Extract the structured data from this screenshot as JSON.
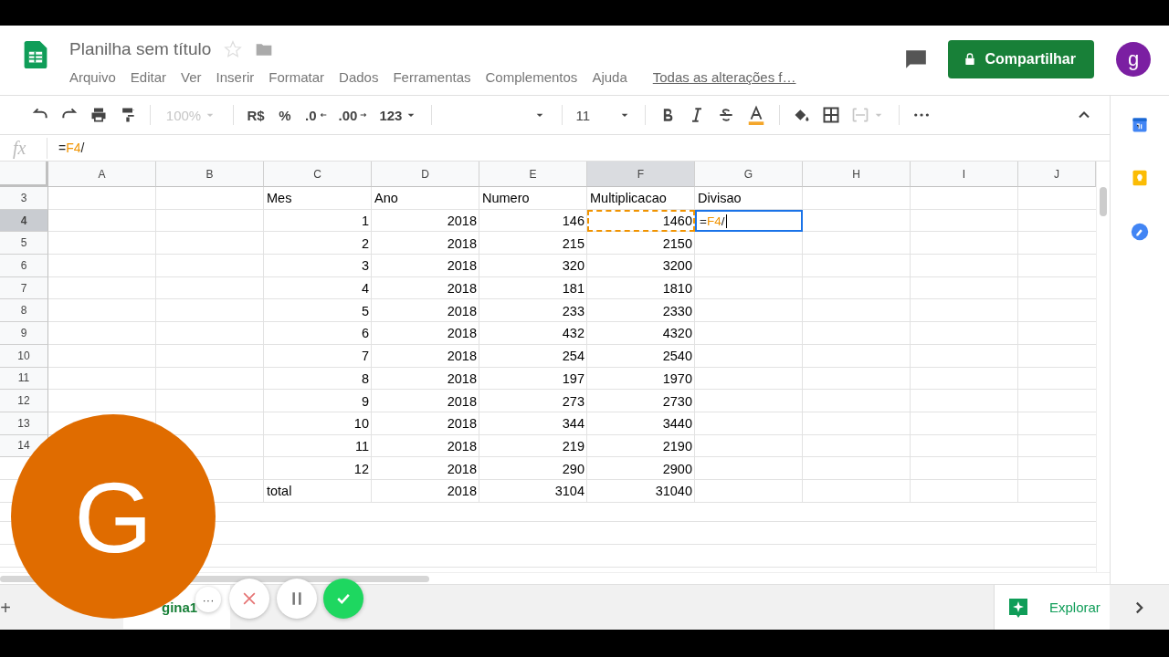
{
  "header": {
    "title": "Planilha sem título",
    "menu": [
      "Arquivo",
      "Editar",
      "Ver",
      "Inserir",
      "Formatar",
      "Dados",
      "Ferramentas",
      "Complementos",
      "Ajuda"
    ],
    "save_status": "Todas as alterações f…",
    "share_button": "Compartilhar",
    "account": "g"
  },
  "toolbar": {
    "zoom": {
      "text": "100%",
      "disabled": true
    },
    "currency": "R$",
    "percent": "%",
    "decrease_decimals": ".0",
    "increase_decimals": ".00",
    "number_format": "123",
    "font_size": "11",
    "merge_disabled": true
  },
  "formula_bar": {
    "label": "fx",
    "parts": [
      {
        "text": "=",
        "ref": false
      },
      {
        "text": "F4",
        "ref": true
      },
      {
        "text": "/",
        "ref": false
      }
    ]
  },
  "columns": [
    {
      "label": "A",
      "selected": false
    },
    {
      "label": "B",
      "selected": false
    },
    {
      "label": "C",
      "selected": false
    },
    {
      "label": "D",
      "selected": false
    },
    {
      "label": "E",
      "selected": false
    },
    {
      "label": "F",
      "selected": true
    },
    {
      "label": "G",
      "selected": false
    },
    {
      "label": "H",
      "selected": false
    },
    {
      "label": "I",
      "selected": false
    },
    {
      "label": "J",
      "selected": false
    }
  ],
  "rows": [
    {
      "number": "3",
      "selected": false,
      "cells": [
        null,
        null,
        {
          "kind": "text",
          "text": "Mes"
        },
        {
          "kind": "text",
          "text": "Ano"
        },
        {
          "kind": "text",
          "text": "Numero"
        },
        {
          "kind": "text",
          "text": "Multiplicacao"
        },
        {
          "kind": "text",
          "text": "Divisao"
        },
        null,
        null,
        null
      ]
    },
    {
      "number": "4",
      "selected": true,
      "cells": [
        null,
        null,
        {
          "kind": "number",
          "text": "1"
        },
        {
          "kind": "number",
          "text": "2018"
        },
        {
          "kind": "number",
          "text": "146"
        },
        {
          "kind": "number",
          "text": "1460",
          "referenced": true
        },
        {
          "kind": "editor",
          "active": true,
          "parts": [
            {
              "text": "=",
              "ref": false
            },
            {
              "text": "F4",
              "ref": true
            },
            {
              "text": "/",
              "ref": false
            }
          ]
        },
        null,
        null,
        null
      ]
    },
    {
      "number": "5",
      "selected": false,
      "cells": [
        null,
        null,
        {
          "kind": "number",
          "text": "2"
        },
        {
          "kind": "number",
          "text": "2018"
        },
        {
          "kind": "number",
          "text": "215"
        },
        {
          "kind": "number",
          "text": "2150"
        },
        null,
        null,
        null,
        null
      ]
    },
    {
      "number": "6",
      "selected": false,
      "cells": [
        null,
        null,
        {
          "kind": "number",
          "text": "3"
        },
        {
          "kind": "number",
          "text": "2018"
        },
        {
          "kind": "number",
          "text": "320"
        },
        {
          "kind": "number",
          "text": "3200"
        },
        null,
        null,
        null,
        null
      ]
    },
    {
      "number": "7",
      "selected": false,
      "cells": [
        null,
        null,
        {
          "kind": "number",
          "text": "4"
        },
        {
          "kind": "number",
          "text": "2018"
        },
        {
          "kind": "number",
          "text": "181"
        },
        {
          "kind": "number",
          "text": "1810"
        },
        null,
        null,
        null,
        null
      ]
    },
    {
      "number": "8",
      "selected": false,
      "cells": [
        null,
        null,
        {
          "kind": "number",
          "text": "5"
        },
        {
          "kind": "number",
          "text": "2018"
        },
        {
          "kind": "number",
          "text": "233"
        },
        {
          "kind": "number",
          "text": "2330"
        },
        null,
        null,
        null,
        null
      ]
    },
    {
      "number": "9",
      "selected": false,
      "cells": [
        null,
        null,
        {
          "kind": "number",
          "text": "6"
        },
        {
          "kind": "number",
          "text": "2018"
        },
        {
          "kind": "number",
          "text": "432"
        },
        {
          "kind": "number",
          "text": "4320"
        },
        null,
        null,
        null,
        null
      ]
    },
    {
      "number": "10",
      "selected": false,
      "cells": [
        null,
        null,
        {
          "kind": "number",
          "text": "7"
        },
        {
          "kind": "number",
          "text": "2018"
        },
        {
          "kind": "number",
          "text": "254"
        },
        {
          "kind": "number",
          "text": "2540"
        },
        null,
        null,
        null,
        null
      ]
    },
    {
      "number": "11",
      "selected": false,
      "cells": [
        null,
        null,
        {
          "kind": "number",
          "text": "8"
        },
        {
          "kind": "number",
          "text": "2018"
        },
        {
          "kind": "number",
          "text": "197"
        },
        {
          "kind": "number",
          "text": "1970"
        },
        null,
        null,
        null,
        null
      ]
    },
    {
      "number": "12",
      "selected": false,
      "cells": [
        null,
        null,
        {
          "kind": "number",
          "text": "9"
        },
        {
          "kind": "number",
          "text": "2018"
        },
        {
          "kind": "number",
          "text": "273"
        },
        {
          "kind": "number",
          "text": "2730"
        },
        null,
        null,
        null,
        null
      ]
    },
    {
      "number": "13",
      "selected": false,
      "cells": [
        null,
        null,
        {
          "kind": "number",
          "text": "10"
        },
        {
          "kind": "number",
          "text": "2018"
        },
        {
          "kind": "number",
          "text": "344"
        },
        {
          "kind": "number",
          "text": "3440"
        },
        null,
        null,
        null,
        null
      ]
    },
    {
      "number": "14",
      "selected": false,
      "cells": [
        null,
        null,
        {
          "kind": "number",
          "text": "11"
        },
        {
          "kind": "number",
          "text": "2018"
        },
        {
          "kind": "number",
          "text": "219"
        },
        {
          "kind": "number",
          "text": "2190"
        },
        null,
        null,
        null,
        null
      ]
    },
    {
      "cells": [
        null,
        null,
        {
          "kind": "number",
          "text": "12"
        },
        {
          "kind": "number",
          "text": "2018"
        },
        {
          "kind": "number",
          "text": "290"
        },
        {
          "kind": "number",
          "text": "2900"
        },
        null,
        null,
        null,
        null
      ]
    },
    {
      "cells": [
        null,
        null,
        {
          "kind": "text",
          "text": "total"
        },
        {
          "kind": "number",
          "text": "2018"
        },
        {
          "kind": "number",
          "text": "3104"
        },
        {
          "kind": "number",
          "text": "31040"
        },
        null,
        null,
        null,
        null
      ]
    }
  ],
  "sheet_bar": {
    "add": "+",
    "tabs": [
      {
        "label": "gina1",
        "selected": true
      }
    ],
    "explore": "Explorar"
  },
  "recorder": {
    "letter": "G",
    "more": "···"
  }
}
